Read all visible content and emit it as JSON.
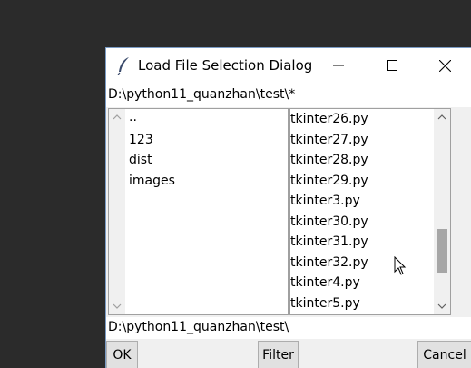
{
  "window": {
    "title": "Load File Selection Dialog",
    "icon": "feather-icon"
  },
  "titlebar_buttons": {
    "minimize": "minimize-icon",
    "maximize": "maximize-icon",
    "close": "close-icon"
  },
  "filter": {
    "value": "D:\\python11_quanzhan\\test\\*"
  },
  "directories": {
    "items": [
      "..",
      "123",
      "dist",
      "images"
    ],
    "scroll_thumb": null
  },
  "files": {
    "items": [
      "tkinter26.py",
      "tkinter27.py",
      "tkinter28.py",
      "tkinter29.py",
      "tkinter3.py",
      "tkinter30.py",
      "tkinter31.py",
      "tkinter32.py",
      "tkinter4.py",
      "tkinter5.py"
    ],
    "scroll_position": 0.8,
    "scroll_visible_fraction": 0.25
  },
  "selection": {
    "value": "D:\\python11_quanzhan\\test\\"
  },
  "buttons": {
    "ok": "OK",
    "filter": "Filter",
    "cancel": "Cancel"
  },
  "colors": {
    "desktop": "#2b2b2b",
    "titlebar": "#ffffff",
    "dialog": "#f0f0f0",
    "scroll_thumb": "#a6a6a6"
  }
}
